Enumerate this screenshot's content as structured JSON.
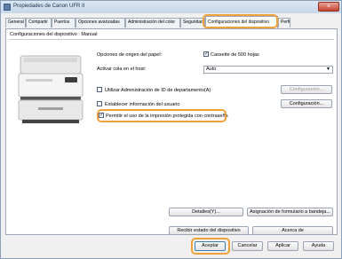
{
  "window": {
    "title": "Propiedades de Canon UFR II",
    "close_label": "×"
  },
  "tabs": [
    {
      "label": "General"
    },
    {
      "label": "Compartir"
    },
    {
      "label": "Puertos"
    },
    {
      "label": "Opciones avanzadas"
    },
    {
      "label": "Administración del color"
    },
    {
      "label": "Seguridad"
    },
    {
      "label": "Configuraciones del dispositivo"
    },
    {
      "label": "Perfil"
    }
  ],
  "panel": {
    "section_label": "Configuraciones del dispositivo : Manual",
    "paper_source_label": "Opciones de origen del papel:",
    "cassette_label": "Cassette de 500 hojas",
    "cassette_checked": true,
    "queue_label": "Activar cola en el host:",
    "queue_value": "Auto",
    "dept_id_label": "Utilizar Administración de ID de departamento(A)",
    "dept_id_checked": false,
    "dept_config_button": "Configuración...",
    "user_info_label": "Establecer información del usuario",
    "user_info_checked": false,
    "user_config_button": "Configuración...",
    "secure_print_label": "Permitir el uso de la impresión protegida con contraseña",
    "secure_print_checked": true,
    "details_button": "Detalles(Y)...",
    "form_button": "Asignación de formulario a bandeja...",
    "status_button": "Recibir estado del dispositivo",
    "about_button": "Acerca de"
  },
  "footer": {
    "accept": "Aceptar",
    "cancel": "Cancelar",
    "apply": "Aplicar",
    "help": "Ayuda"
  }
}
